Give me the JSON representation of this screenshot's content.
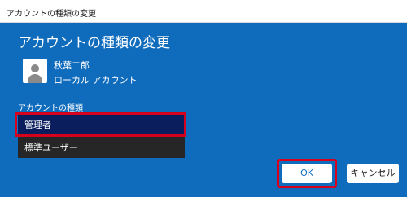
{
  "window": {
    "title": "アカウントの種類の変更"
  },
  "dialog": {
    "heading": "アカウントの種類の変更",
    "user": {
      "name": "秋葉二郎",
      "account_type": "ローカル アカウント",
      "avatar_icon": "user-avatar-icon"
    },
    "type_label": "アカウントの種類",
    "options": [
      "管理者",
      "標準ユーザー"
    ],
    "selected_option": "管理者",
    "ok_label": "OK",
    "cancel_label": "キャンセル"
  },
  "colors": {
    "background": "#0f6cbd",
    "highlight": "#d6001c",
    "selected_item": "#0a1e5e",
    "list_background": "#202020"
  }
}
